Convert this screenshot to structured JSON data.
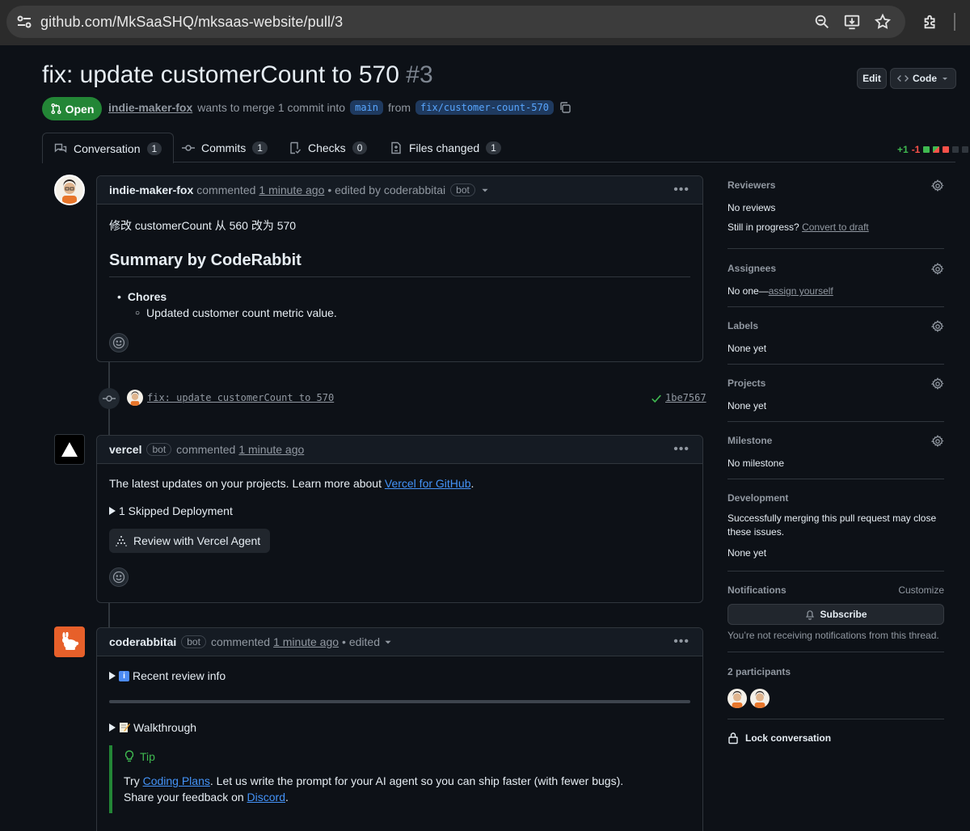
{
  "browser": {
    "url": "github.com/MkSaaSHQ/mksaas-website/pull/3"
  },
  "pr": {
    "title": "fix: update customerCount to 570",
    "number": "#3",
    "state": "Open",
    "author": "indie-maker-fox",
    "meta_text": "wants to merge 1 commit into",
    "base_branch": "main",
    "from_text": "from",
    "head_branch": "fix/customer-count-570",
    "edit_label": "Edit",
    "code_label": "Code"
  },
  "tabs": [
    {
      "label": "Conversation",
      "count": "1",
      "icon": "comment-discussion-icon"
    },
    {
      "label": "Commits",
      "count": "1",
      "icon": "git-commit-icon"
    },
    {
      "label": "Checks",
      "count": "0",
      "icon": "checklist-icon"
    },
    {
      "label": "Files changed",
      "count": "1",
      "icon": "file-diff-icon"
    }
  ],
  "diffstat": {
    "additions": "+1",
    "deletions": "-1",
    "add_color": "#3fb950",
    "del_color": "#f85149"
  },
  "comments": [
    {
      "author": "indie-maker-fox",
      "action": "commented",
      "time": "1 minute ago",
      "edited": "• edited by coderabbitai",
      "bot_label": "bot",
      "body_line": "修改 customerCount 从 560 改为 570",
      "summary_heading": "Summary by CodeRabbit",
      "list_item": "Chores",
      "sub_item": "Updated customer count metric value."
    },
    {
      "author": "vercel",
      "bot_label": "bot",
      "action": "commented",
      "time": "1 minute ago",
      "body_prefix": "The latest updates on your projects. Learn more about ",
      "link_text": "Vercel for GitHub",
      "body_suffix": ".",
      "skipped": "1 Skipped Deployment",
      "agent_button": "Review with Vercel Agent"
    },
    {
      "author": "coderabbitai",
      "bot_label": "bot",
      "action": "commented",
      "time": "1 minute ago",
      "edited": "• edited",
      "recent_review": "Recent review info",
      "walkthrough": "Walkthrough",
      "tip_title": "Tip",
      "tip_prefix": "Try ",
      "tip_link": "Coding Plans",
      "tip_rest": ". Let us write the prompt for your AI agent so you can ship faster (with fewer bugs).",
      "share_prefix": "Share your feedback on ",
      "share_link": "Discord",
      "share_suffix": "."
    }
  ],
  "commit": {
    "message": "fix: update customerCount to 570",
    "sha": "1be7567"
  },
  "sidebar": {
    "reviewers": {
      "title": "Reviewers",
      "value": "No reviews",
      "progress_text": "Still in progress?",
      "progress_link": "Convert to draft"
    },
    "assignees": {
      "title": "Assignees",
      "value_prefix": "No one—",
      "value_link": "assign yourself"
    },
    "labels": {
      "title": "Labels",
      "value": "None yet"
    },
    "projects": {
      "title": "Projects",
      "value": "None yet"
    },
    "milestone": {
      "title": "Milestone",
      "value": "No milestone"
    },
    "development": {
      "title": "Development",
      "value": "Successfully merging this pull request may close these issues.",
      "sub": "None yet"
    },
    "notifications": {
      "title": "Notifications",
      "customize": "Customize",
      "subscribe": "Subscribe",
      "note": "You’re not receiving notifications from this thread."
    },
    "participants": {
      "title": "2 participants"
    },
    "lock": "Lock conversation"
  }
}
